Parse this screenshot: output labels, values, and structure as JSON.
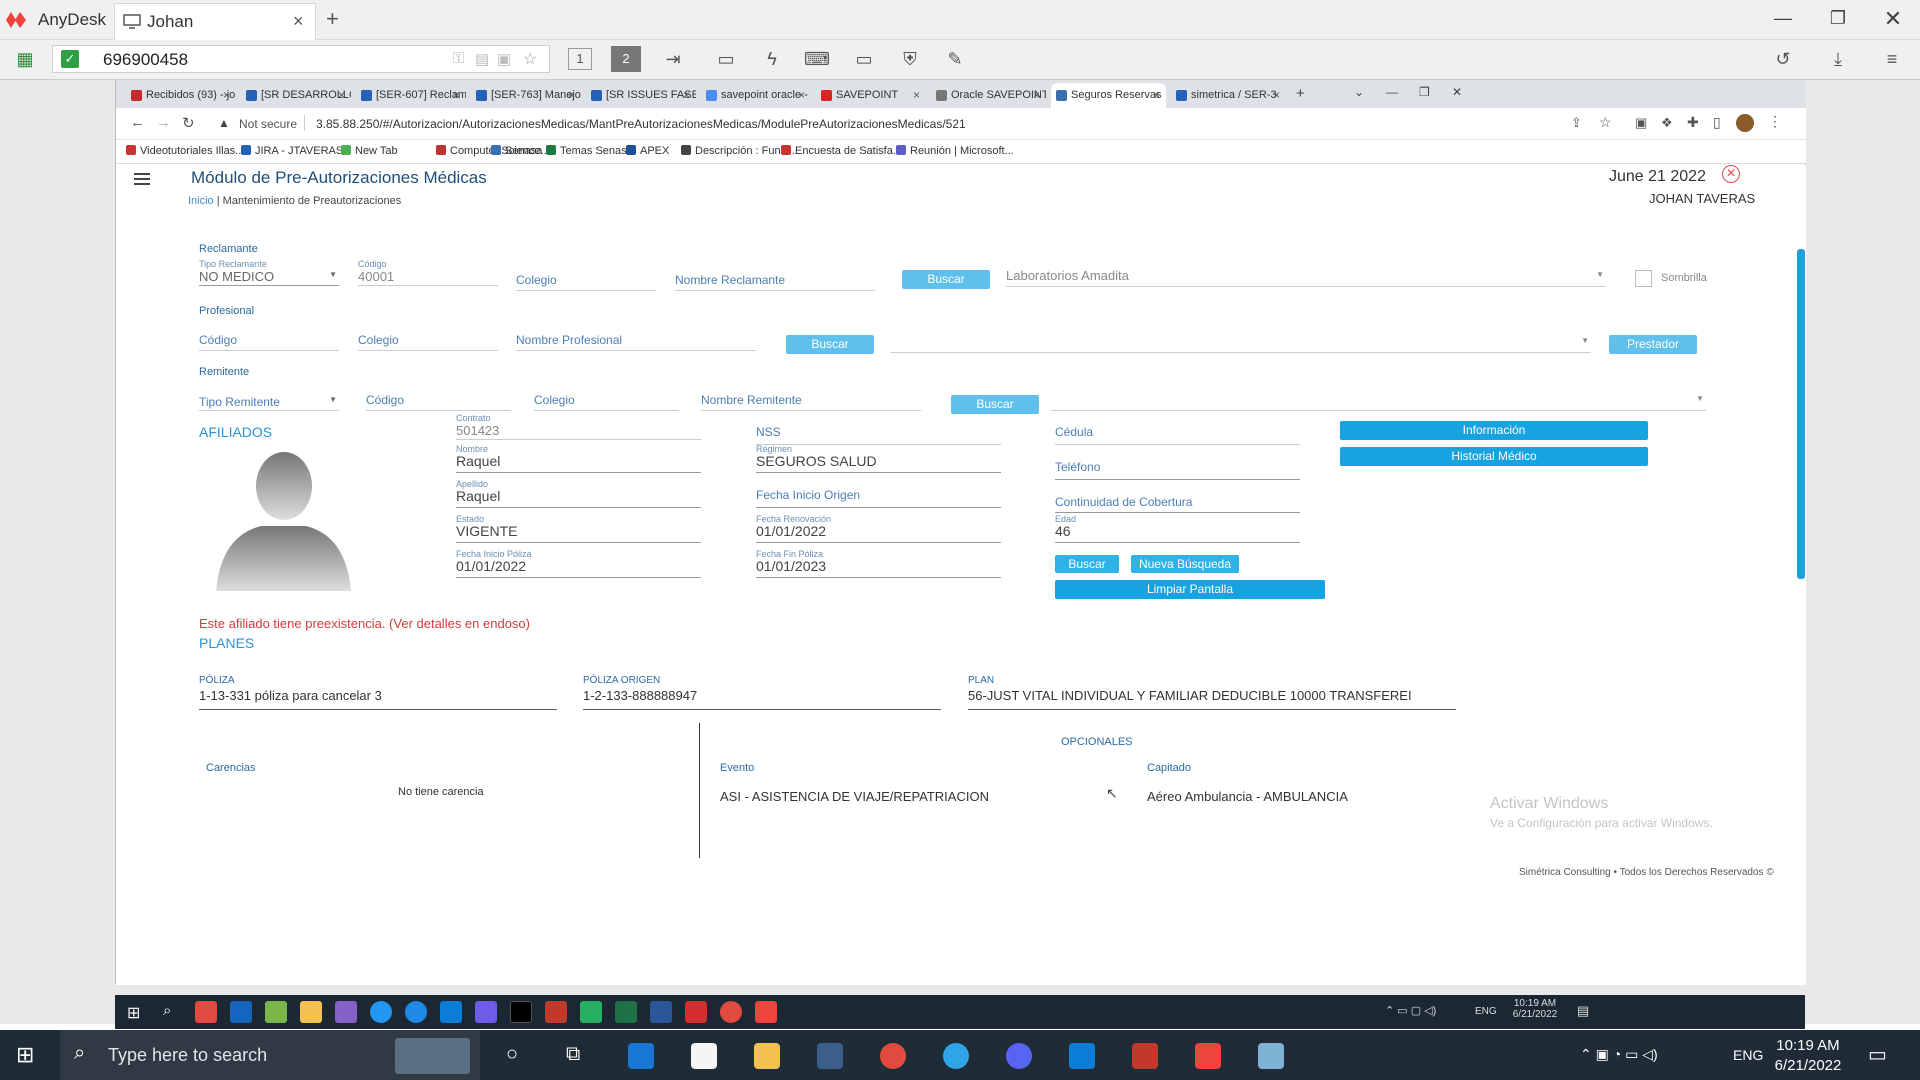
{
  "anydesk": {
    "brand": "AnyDesk",
    "tab_label": "Johan",
    "address": "696900458",
    "tab_close": "×",
    "tab_new": "+"
  },
  "chrome_tabs": [
    {
      "label": "Recibidos (93) - joh",
      "color": "#c62b2b"
    },
    {
      "label": "[SR DESARROLLO",
      "color": "#2561b8"
    },
    {
      "label": "[SER-607] Reclama",
      "color": "#2561b8"
    },
    {
      "label": "[SER-763] Manejo",
      "color": "#2561b8"
    },
    {
      "label": "[SR ISSUES FASE II",
      "color": "#2561b8"
    },
    {
      "label": "savepoint oracle -",
      "color": "#4a8af4"
    },
    {
      "label": "SAVEPOINT",
      "color": "#d22"
    },
    {
      "label": "Oracle SAVEPOINT",
      "color": "#777"
    },
    {
      "label": "Seguros Reservas",
      "color": "#3a6fb0"
    },
    {
      "label": "simetrica / SER-3",
      "color": "#2561b8"
    }
  ],
  "omnibar": {
    "security": "Not secure",
    "url": "3.85.88.250/#/Autorizacion/AutorizacionesMedicas/MantPreAutorizacionesMedicas/ModulePreAutorizacionesMedicas/521"
  },
  "bookmarks": [
    {
      "label": "Videotutoriales Illas...",
      "color": "#c33"
    },
    {
      "label": "JIRA - JTAVERAS",
      "color": "#2561b8"
    },
    {
      "label": "New Tab",
      "color": "#4caf50"
    },
    {
      "label": "Computer Science...",
      "color": "#b33"
    },
    {
      "label": "Senasa",
      "color": "#3a6fb0"
    },
    {
      "label": "Temas Senasa",
      "color": "#1d7a45"
    },
    {
      "label": "APEX",
      "color": "#1e4f9a"
    },
    {
      "label": "Descripción : Funci...",
      "color": "#444"
    },
    {
      "label": "Encuesta de Satisfa...",
      "color": "#c33"
    },
    {
      "label": "Reunión | Microsoft...",
      "color": "#5b5fc7"
    }
  ],
  "header": {
    "title": "Módulo de Pre-Autorizaciones Médicas",
    "date": "June 21 2022",
    "user": "JOHAN TAVERAS",
    "breadcrumb_home": "Inicio",
    "breadcrumb_sep": "|",
    "breadcrumb_current": "Mantenimiento de Preautorizaciones"
  },
  "reclamante": {
    "section": "Reclamante",
    "tipo_label": "Tipo Reclamante",
    "tipo_value": "NO MEDICO",
    "codigo_label": "Código",
    "codigo_value": "40001",
    "colegio": "Colegio",
    "nombre": "Nombre Reclamante",
    "buscar": "Buscar",
    "select_value": "Laboratorios Amadita",
    "sombrilla": "Sombrilla"
  },
  "profesional": {
    "section": "Profesional",
    "codigo": "Código",
    "colegio": "Colegio",
    "nombre": "Nombre Profesional",
    "buscar": "Buscar",
    "prestador": "Prestador"
  },
  "remitente": {
    "section": "Remitente",
    "tipo": "Tipo Remitente",
    "codigo": "Código",
    "colegio": "Colegio",
    "nombre": "Nombre Remitente",
    "buscar": "Buscar"
  },
  "afiliados": {
    "title": "AFILIADOS",
    "contrato_label": "Contrato",
    "contrato": "501423",
    "nombre_label": "Nombre",
    "nombre": "Raquel",
    "apellido_label": "Apellido",
    "apellido": "Raquel",
    "estado_label": "Estado",
    "estado": "VIGENTE",
    "fip_label": "Fecha Inicio Póliza",
    "fip": "01/01/2022",
    "nss": "NSS",
    "regimen_label": "Régimen",
    "regimen": "SEGUROS SALUD",
    "fio": "Fecha Inicio Origen",
    "fr_label": "Fecha Renovación",
    "fr": "01/01/2022",
    "ffp_label": "Fecha Fin Póliza",
    "ffp": "01/01/2023",
    "cedula": "Cédula",
    "telefono": "Teléfono",
    "continuidad": "Continuidad de Cobertura",
    "edad_label": "Edad",
    "edad": "46",
    "buscar": "Buscar",
    "nueva": "Nueva Búsqueda",
    "limpiar": "Limpiar Pantalla",
    "informacion": "Información",
    "historial": "Historial Médico",
    "warning": "Este afiliado tiene preexistencia. (Ver detalles en endoso)"
  },
  "planes": {
    "title": "PLANES",
    "poliza_label": "PÓLIZA",
    "poliza": "1-13-331 póliza para cancelar 3",
    "origen_label": "PÓLIZA ORIGEN",
    "origen": "1-2-133-888888947",
    "plan_label": "PLAN",
    "plan": "56-JUST VITAL INDIVIDUAL Y FAMILIAR DEDUCIBLE 10000 TRANSFEREI",
    "opcionales": "OPCIONALES",
    "carencias": "Carencias",
    "sin_carencia": "No tiene carencia",
    "evento_label": "Evento",
    "evento": "ASI - ASISTENCIA DE VIAJE/REPATRIACION",
    "capitado_label": "Capitado",
    "capitado": "Aéreo Ambulancia - AMBULANCIA"
  },
  "watermark": {
    "line1": "Activar Windows",
    "line2": "Ve a Configuración para activar Windows."
  },
  "footer": "Simétrica Consulting • Todos los Derechos Reservados ©",
  "remote_tray": {
    "time": "10:19 AM",
    "date": "6/21/2022",
    "lang": "ENG"
  },
  "taskbar": {
    "search_placeholder": "Type here to search",
    "time": "10:19 AM",
    "date": "6/21/2022",
    "lang": "ENG"
  }
}
